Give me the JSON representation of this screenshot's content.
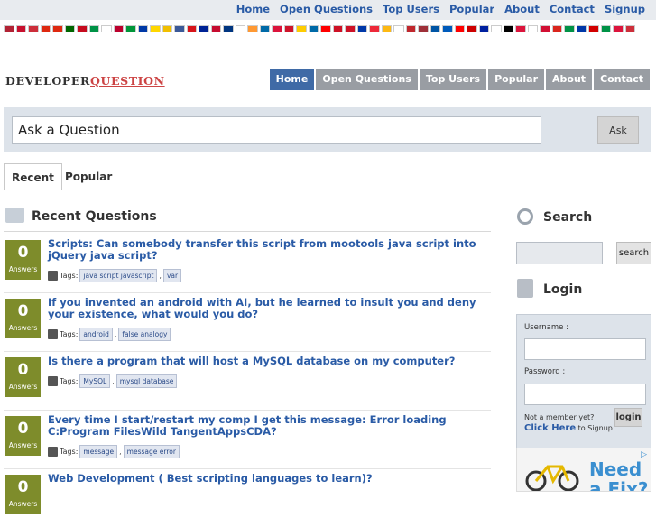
{
  "top_nav": [
    "Home",
    "Open Questions",
    "Top Users",
    "Popular",
    "About",
    "Contact",
    "Signup"
  ],
  "flag_colors": [
    "#b22234",
    "#c8102e",
    "#cd2e3a",
    "#de2910",
    "#de2910",
    "#006600",
    "#c60b1e",
    "#009246",
    "#ffffff",
    "#bc002d",
    "#009639",
    "#0039a6",
    "#ffd700",
    "#f1bf00",
    "#3b5998",
    "#d7141a",
    "#002395",
    "#c60c30",
    "#003580",
    "#ffffff",
    "#ff9933",
    "#006aa7",
    "#dc143c",
    "#cf142b",
    "#fecc00",
    "#006aa7",
    "#ff0000",
    "#ce1126",
    "#ce1126",
    "#0038a8",
    "#ed2939",
    "#fdb913",
    "#ffffff",
    "#c1272d",
    "#9e3039",
    "#0055a4",
    "#005bbb",
    "#ff0000",
    "#cd0000",
    "#00209f",
    "#ffffff",
    "#000000",
    "#dc143c",
    "#ffffff",
    "#d21034",
    "#da251d",
    "#009246",
    "#0038a8",
    "#d20000",
    "#009246",
    "#dc143c",
    "#cd2e3a"
  ],
  "brand": {
    "part1": "DEVELOPER",
    "part2": "QUESTION"
  },
  "main_nav": [
    {
      "label": "Home",
      "active": true
    },
    {
      "label": "Open Questions",
      "active": false
    },
    {
      "label": "Top Users",
      "active": false
    },
    {
      "label": "Popular",
      "active": false
    },
    {
      "label": "About",
      "active": false
    },
    {
      "label": "Contact",
      "active": false
    }
  ],
  "ask": {
    "placeholder": "Ask a Question",
    "button": "Ask"
  },
  "tabs": {
    "recent": "Recent",
    "popular": "Popular"
  },
  "recent_heading": "Recent Questions",
  "answers_label": "Answers",
  "tags_label": "Tags:",
  "questions": [
    {
      "answers": "0",
      "title": "Scripts: Can somebody transfer this script from mootools java script into jQuery java script?",
      "tags": [
        "java script javascript",
        "var"
      ]
    },
    {
      "answers": "0",
      "title": "If you invented an android with AI, but he learned to insult you and deny your existence, what would you do?",
      "tags": [
        "android",
        "false analogy"
      ]
    },
    {
      "answers": "0",
      "title": "Is there a program that will host a MySQL database on my computer?",
      "tags": [
        "MySQL",
        "mysql database"
      ]
    },
    {
      "answers": "0",
      "title": "Every time I start/restart my comp I get this message: Error loading C:Program FilesWild TangentAppsCDA?",
      "tags": [
        "message",
        "message error"
      ]
    },
    {
      "answers": "0",
      "title": "Web Development ( Best scripting languages to learn)?",
      "tags": []
    }
  ],
  "sidebar": {
    "search_heading": "Search",
    "search_button": "search",
    "login_heading": "Login",
    "username_label": "Username :",
    "password_label": "Password :",
    "not_member": "Not a member yet?",
    "click_here": "Click Here",
    "to_signup": "to Signup",
    "login_button": "login"
  },
  "ad": {
    "text": "Need a Fix?"
  }
}
